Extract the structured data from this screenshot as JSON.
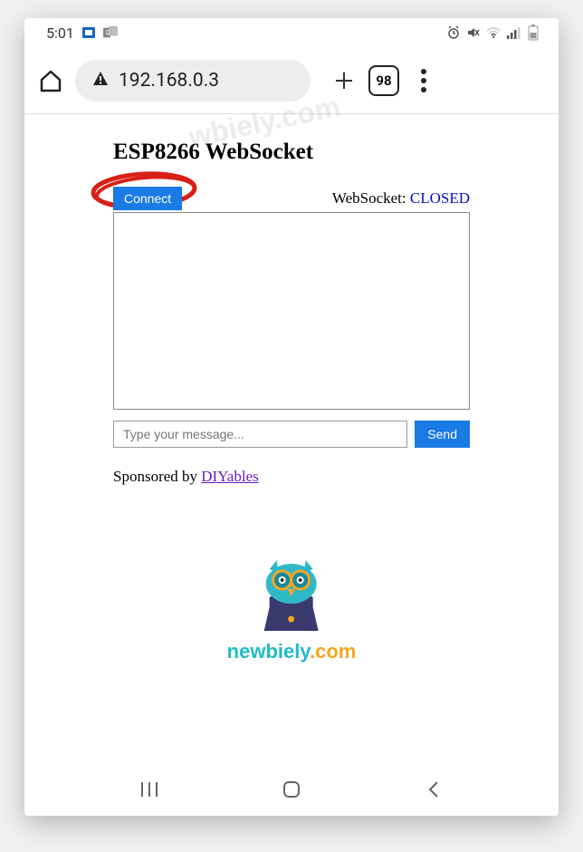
{
  "status_bar": {
    "time": "5:01"
  },
  "browser": {
    "url": "192.168.0.3",
    "tab_count": "98"
  },
  "page": {
    "title": "ESP8266 WebSocket",
    "connect_label": "Connect",
    "ws_status_label": "WebSocket: ",
    "ws_status_value": "CLOSED",
    "message_placeholder": "Type your message...",
    "send_label": "Send",
    "sponsor_label": "Sponsored by ",
    "sponsor_link": "DIYables"
  },
  "branding": {
    "text": "newbiely",
    "suffix": ".com",
    "watermark": "wbiely.com"
  }
}
